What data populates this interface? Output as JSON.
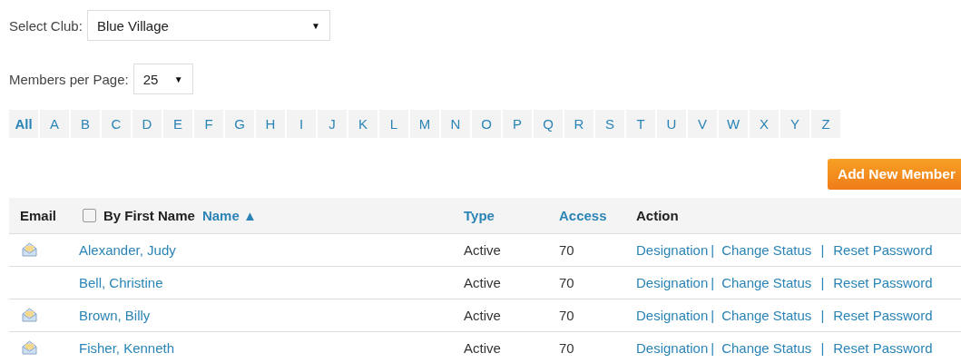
{
  "club_select": {
    "label": "Select Club:",
    "value": "Blue Village",
    "caret": "▼"
  },
  "per_page_select": {
    "label": "Members per Page:",
    "value": "25",
    "caret": "▼"
  },
  "letters": [
    {
      "label": "All",
      "selected": true
    },
    {
      "label": "A",
      "selected": false
    },
    {
      "label": "B",
      "selected": false
    },
    {
      "label": "C",
      "selected": false
    },
    {
      "label": "D",
      "selected": false
    },
    {
      "label": "E",
      "selected": false
    },
    {
      "label": "F",
      "selected": false
    },
    {
      "label": "G",
      "selected": false
    },
    {
      "label": "H",
      "selected": false
    },
    {
      "label": "I",
      "selected": false
    },
    {
      "label": "J",
      "selected": false
    },
    {
      "label": "K",
      "selected": false
    },
    {
      "label": "L",
      "selected": false
    },
    {
      "label": "M",
      "selected": false
    },
    {
      "label": "N",
      "selected": false
    },
    {
      "label": "O",
      "selected": false
    },
    {
      "label": "P",
      "selected": false
    },
    {
      "label": "Q",
      "selected": false
    },
    {
      "label": "R",
      "selected": false
    },
    {
      "label": "S",
      "selected": false
    },
    {
      "label": "T",
      "selected": false
    },
    {
      "label": "U",
      "selected": false
    },
    {
      "label": "V",
      "selected": false
    },
    {
      "label": "W",
      "selected": false
    },
    {
      "label": "X",
      "selected": false
    },
    {
      "label": "Y",
      "selected": false
    },
    {
      "label": "Z",
      "selected": false
    }
  ],
  "add_button": "Add New Member",
  "table": {
    "header": {
      "email": "Email",
      "by_first_name": {
        "label": "By First Name",
        "checked": false
      },
      "name": {
        "label": "Name",
        "sort_indicator": "▲"
      },
      "type": "Type",
      "access": "Access",
      "action": "Action"
    },
    "action_separator": "|",
    "rows": [
      {
        "has_email": true,
        "name": "Alexander, Judy",
        "type": "Active",
        "access": "70",
        "actions": [
          "Designation",
          "Change Status",
          "Reset Password"
        ]
      },
      {
        "has_email": false,
        "name": "Bell, Christine",
        "type": "Active",
        "access": "70",
        "actions": [
          "Designation",
          "Change Status",
          "Reset Password"
        ]
      },
      {
        "has_email": true,
        "name": "Brown, Billy",
        "type": "Active",
        "access": "70",
        "actions": [
          "Designation",
          "Change Status",
          "Reset Password"
        ]
      },
      {
        "has_email": true,
        "name": "Fisher, Kenneth",
        "type": "Active",
        "access": "70",
        "actions": [
          "Designation",
          "Change Status",
          "Reset Password"
        ]
      }
    ]
  }
}
